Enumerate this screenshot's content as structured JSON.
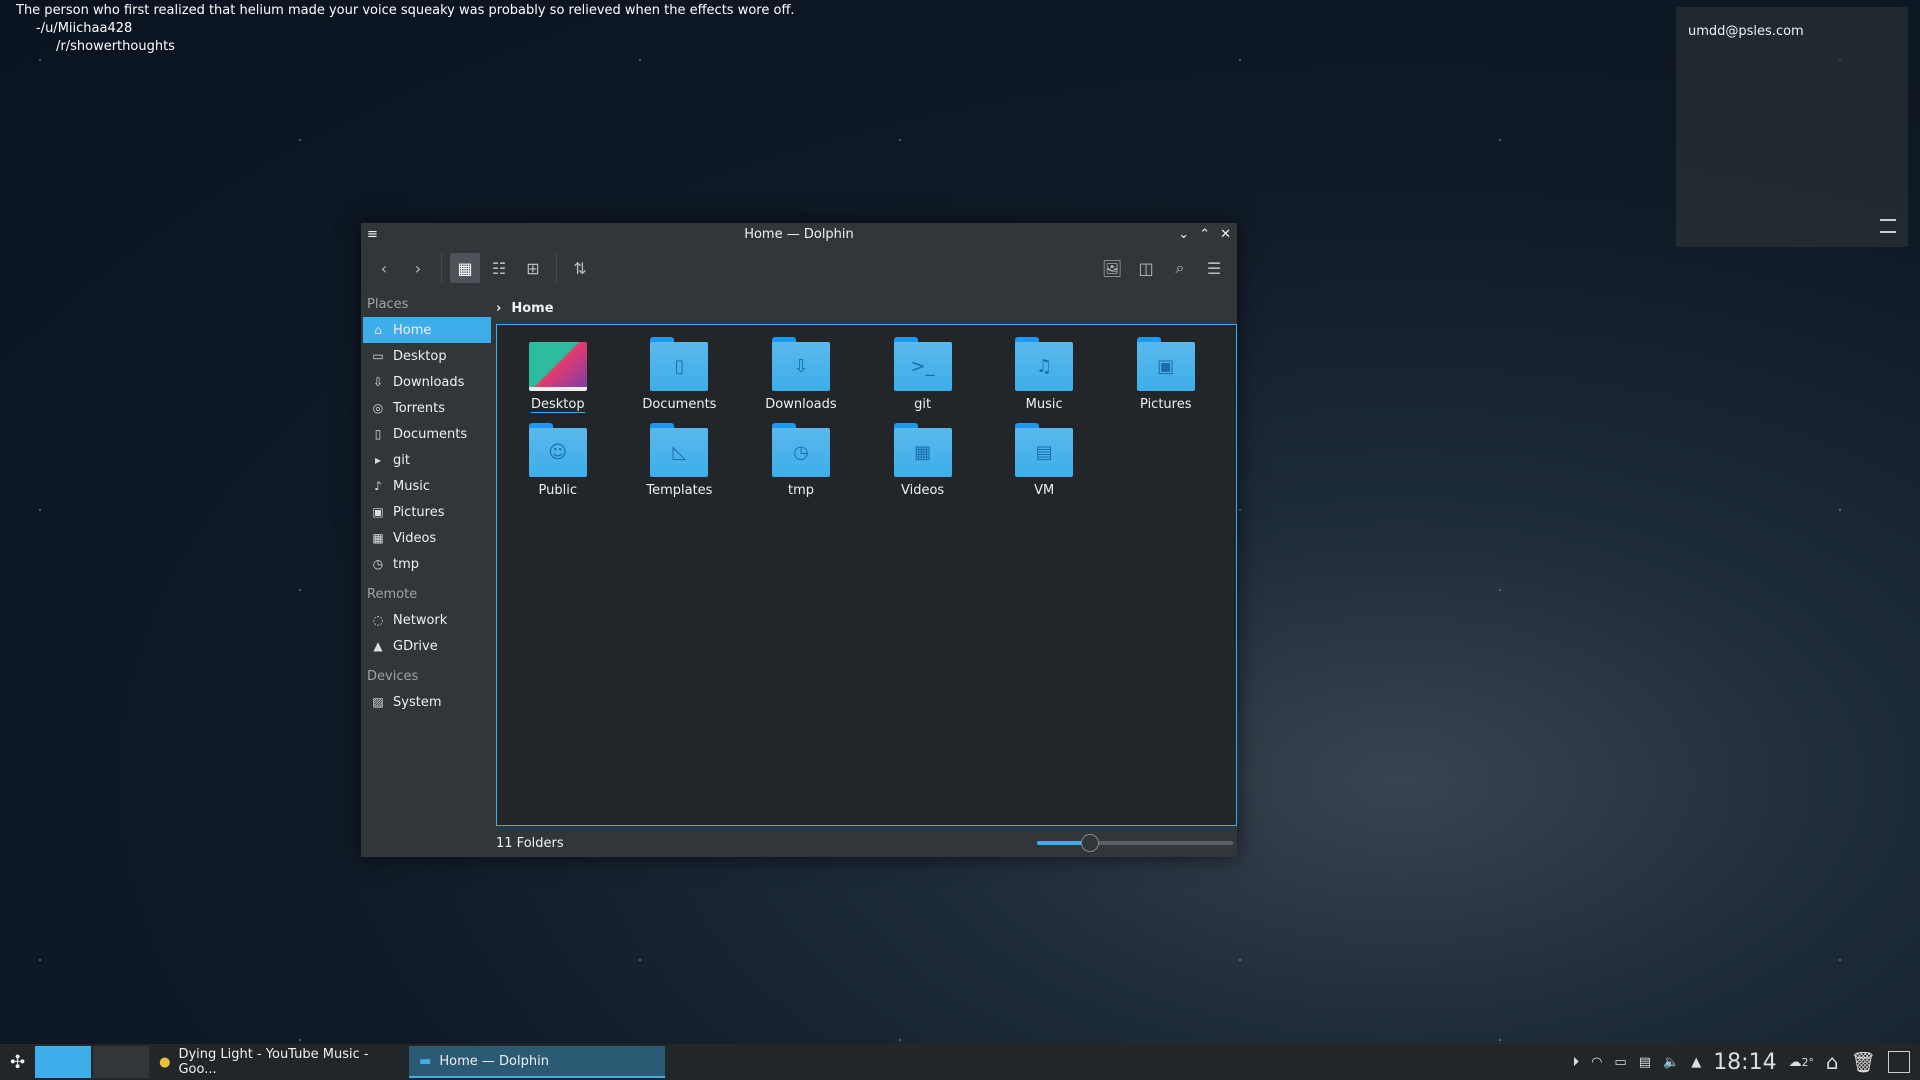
{
  "desktop": {
    "quote": [
      "The person who first realized that helium made your voice squeaky was probably so relieved when the effects wore off.",
      "-/u/Miichaa428",
      "/r/showerthoughts"
    ],
    "notification_account": "umdd@psles.com"
  },
  "window": {
    "title": "Home — Dolphin",
    "places_header": "Places",
    "remote_header": "Remote",
    "devices_header": "Devices",
    "places": [
      {
        "label": "Home",
        "icon": "home-icon",
        "selected": true
      },
      {
        "label": "Desktop",
        "icon": "desktop-icon"
      },
      {
        "label": "Downloads",
        "icon": "download-icon"
      },
      {
        "label": "Torrents",
        "icon": "torrent-icon"
      },
      {
        "label": "Documents",
        "icon": "document-icon"
      },
      {
        "label": "git",
        "icon": "terminal-icon"
      },
      {
        "label": "Music",
        "icon": "music-icon"
      },
      {
        "label": "Pictures",
        "icon": "picture-icon"
      },
      {
        "label": "Videos",
        "icon": "video-icon"
      },
      {
        "label": "tmp",
        "icon": "clock-icon"
      }
    ],
    "remote": [
      {
        "label": "Network",
        "icon": "network-icon"
      },
      {
        "label": "GDrive",
        "icon": "gdrive-icon"
      }
    ],
    "devices": [
      {
        "label": "System",
        "icon": "drive-icon"
      }
    ],
    "breadcrumb": "Home",
    "folders": [
      {
        "label": "Desktop",
        "glyph": ""
      },
      {
        "label": "Documents",
        "glyph": "▯"
      },
      {
        "label": "Downloads",
        "glyph": "⇩"
      },
      {
        "label": "git",
        "glyph": ">_"
      },
      {
        "label": "Music",
        "glyph": "♫"
      },
      {
        "label": "Pictures",
        "glyph": "▣"
      },
      {
        "label": "Public",
        "glyph": "☺"
      },
      {
        "label": "Templates",
        "glyph": "◺"
      },
      {
        "label": "tmp",
        "glyph": "◷"
      },
      {
        "label": "Videos",
        "glyph": "▦"
      },
      {
        "label": "VM",
        "glyph": "▤"
      }
    ],
    "status": "11 Folders",
    "zoom_percent": 27
  },
  "taskbar": {
    "tasks": [
      "Dying Light - YouTube Music - Goo...",
      "Home — Dolphin"
    ],
    "clock": "18:14",
    "weather": "2°"
  },
  "colors": {
    "accent": "#3daee9",
    "window_bg": "#31363b",
    "view_bg": "#232629"
  }
}
